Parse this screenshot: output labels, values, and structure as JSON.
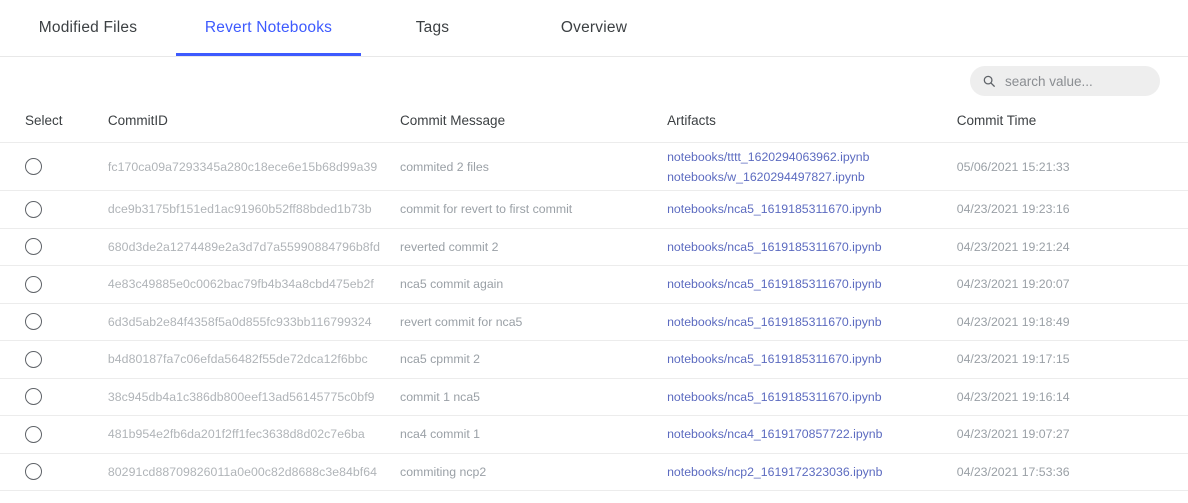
{
  "tabs": [
    {
      "label": "Modified Files",
      "active": false
    },
    {
      "label": "Revert Notebooks",
      "active": true
    },
    {
      "label": "Tags",
      "active": false
    },
    {
      "label": "Overview",
      "active": false
    }
  ],
  "search": {
    "placeholder": "search value...",
    "value": "",
    "icon": "search-icon"
  },
  "colors": {
    "accent": "#3d5afe",
    "link": "#5c6bc0",
    "muted": "#9aa0a6",
    "search_bg": "#eeeeee"
  },
  "table": {
    "columns": [
      "Select",
      "CommitID",
      "Commit Message",
      "Artifacts",
      "Commit Time"
    ],
    "rows": [
      {
        "commit_id": "fc170ca09a7293345a280c18ece6e15b68d99a39",
        "message": "commited 2 files",
        "artifacts": [
          "notebooks/tttt_1620294063962.ipynb",
          "notebooks/w_1620294497827.ipynb"
        ],
        "time": "05/06/2021 15:21:33"
      },
      {
        "commit_id": "dce9b3175bf151ed1ac91960b52ff88bded1b73b",
        "message": "commit for revert to first commit",
        "artifacts": [
          "notebooks/nca5_1619185311670.ipynb"
        ],
        "time": "04/23/2021 19:23:16"
      },
      {
        "commit_id": "680d3de2a1274489e2a3d7d7a55990884796b8fd",
        "message": "reverted commit 2",
        "artifacts": [
          "notebooks/nca5_1619185311670.ipynb"
        ],
        "time": "04/23/2021 19:21:24"
      },
      {
        "commit_id": "4e83c49885e0c0062bac79fb4b34a8cbd475eb2f",
        "message": "nca5 commit again",
        "artifacts": [
          "notebooks/nca5_1619185311670.ipynb"
        ],
        "time": "04/23/2021 19:20:07"
      },
      {
        "commit_id": "6d3d5ab2e84f4358f5a0d855fc933bb116799324",
        "message": "revert commit for nca5",
        "artifacts": [
          "notebooks/nca5_1619185311670.ipynb"
        ],
        "time": "04/23/2021 19:18:49"
      },
      {
        "commit_id": "b4d80187fa7c06efda56482f55de72dca12f6bbc",
        "message": "nca5 cpmmit 2",
        "artifacts": [
          "notebooks/nca5_1619185311670.ipynb"
        ],
        "time": "04/23/2021 19:17:15"
      },
      {
        "commit_id": "38c945db4a1c386db800eef13ad56145775c0bf9",
        "message": "commit 1 nca5",
        "artifacts": [
          "notebooks/nca5_1619185311670.ipynb"
        ],
        "time": "04/23/2021 19:16:14"
      },
      {
        "commit_id": "481b954e2fb6da201f2ff1fec3638d8d02c7e6ba",
        "message": "nca4 commit 1",
        "artifacts": [
          "notebooks/nca4_1619170857722.ipynb"
        ],
        "time": "04/23/2021 19:07:27"
      },
      {
        "commit_id": "80291cd88709826011a0e00c82d8688c3e84bf64",
        "message": "commiting ncp2",
        "artifacts": [
          "notebooks/ncp2_1619172323036.ipynb"
        ],
        "time": "04/23/2021 17:53:36"
      }
    ]
  }
}
